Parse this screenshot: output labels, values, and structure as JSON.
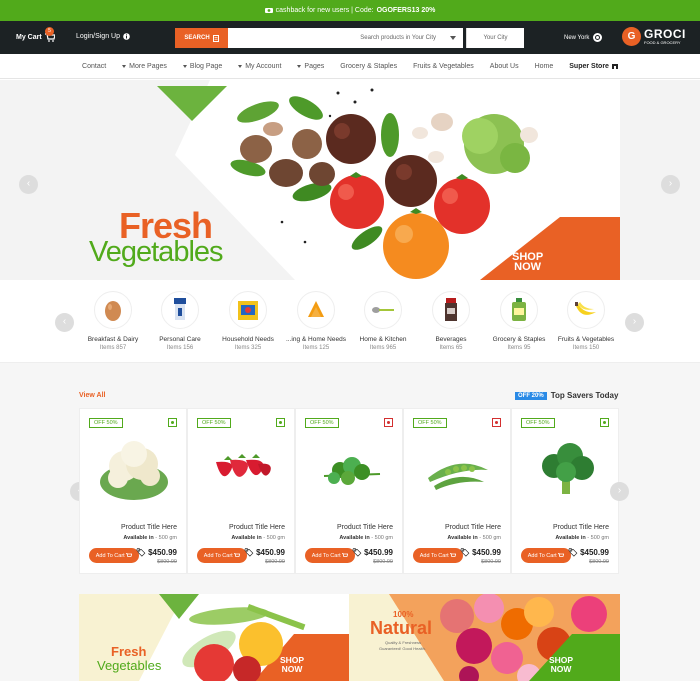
{
  "topbar": {
    "text": "cashback for new users | Code:",
    "code": "OGOFERS13 20%"
  },
  "header": {
    "cart_label": "My Cart",
    "cart_count": "5",
    "login_label": "Login/Sign Up",
    "search_button": "SEARCH",
    "search_placeholder": "Search products in Your City",
    "city_placeholder": "Your City",
    "location": "New York",
    "logo_name": "GROCI",
    "logo_tagline": "FOOD & GROCERY"
  },
  "nav": {
    "items": [
      {
        "label": "Contact",
        "caret": false
      },
      {
        "label": "More Pages",
        "caret": true
      },
      {
        "label": "Blog Page",
        "caret": true
      },
      {
        "label": "My Account",
        "caret": true
      },
      {
        "label": "Pages",
        "caret": true
      },
      {
        "label": "Grocery & Staples",
        "caret": false
      },
      {
        "label": "Fruits & Vegetables",
        "caret": false
      },
      {
        "label": "About Us",
        "caret": false
      },
      {
        "label": "Home",
        "caret": false
      },
      {
        "label": "Super Store",
        "caret": false
      }
    ]
  },
  "hero": {
    "title_line1": "Fresh",
    "title_line2": "Vegetables",
    "shop_now_line1": "SHOP",
    "shop_now_line2": "NOW"
  },
  "categories": [
    {
      "name": "Breakfast & Dairy",
      "count": "Items 857",
      "icon": "egg-icon"
    },
    {
      "name": "Personal Care",
      "count": "Items 156",
      "icon": "toothpaste-icon"
    },
    {
      "name": "Household Needs",
      "count": "Items 325",
      "icon": "detergent-icon"
    },
    {
      "name": "...ing & Home Needs",
      "count": "Items 125",
      "icon": "snack-icon"
    },
    {
      "name": "Home & Kitchen",
      "count": "Items 965",
      "icon": "spoon-icon"
    },
    {
      "name": "Beverages",
      "count": "Items 65",
      "icon": "coffee-jar-icon"
    },
    {
      "name": "Grocery & Staples",
      "count": "Items 95",
      "icon": "bottle-icon"
    },
    {
      "name": "Fruits & Vegetables",
      "count": "Items 150",
      "icon": "banana-icon"
    }
  ],
  "products_section": {
    "view_all": "View All",
    "badge": "OFF 20%",
    "heading": "Top Savers Today"
  },
  "products": [
    {
      "off": "OFF 50%",
      "title": "Product Title Here",
      "avail_label": "Available in",
      "avail_value": "- 500 gm",
      "add_label": "Add To Cart",
      "price": "$450.99",
      "old_price": "$800.99",
      "veg": "green",
      "image": "cauliflower"
    },
    {
      "off": "OFF 50%",
      "title": "Product Title Here",
      "avail_label": "Available in",
      "avail_value": "- 500 gm",
      "add_label": "Add To Cart",
      "price": "$450.99",
      "old_price": "$800.99",
      "veg": "green",
      "image": "strawberries"
    },
    {
      "off": "OFF 50%",
      "title": "Product Title Here",
      "avail_label": "Available in",
      "avail_value": "- 500 gm",
      "add_label": "Add To Cart",
      "price": "$450.99",
      "old_price": "$800.99",
      "veg": "red",
      "image": "parsley"
    },
    {
      "off": "OFF 50%",
      "title": "Product Title Here",
      "avail_label": "Available in",
      "avail_value": "- 500 gm",
      "add_label": "Add To Cart",
      "price": "$450.99",
      "old_price": "$800.99",
      "veg": "red",
      "image": "peas"
    },
    {
      "off": "OFF 50%",
      "title": "Product Title Here",
      "avail_label": "Available in",
      "avail_value": "- 500 gm",
      "add_label": "Add To Cart",
      "price": "$450.99",
      "old_price": "$800.99",
      "veg": "green",
      "image": "broccoli"
    }
  ],
  "banners": [
    {
      "line1": "Fresh",
      "line2": "Vegetables",
      "shop1": "SHOP",
      "shop2": "NOW"
    },
    {
      "pct": "100%",
      "word": "Natural",
      "sub1": "Quality & Freshness",
      "sub2": "Guaranteed! Good Health.",
      "shop1": "SHOP",
      "shop2": "NOW"
    }
  ],
  "colors": {
    "brand_green": "#51aa1b",
    "brand_orange": "#e96125",
    "header_dark": "#1c2224",
    "badge_blue": "#2a8ae6"
  }
}
